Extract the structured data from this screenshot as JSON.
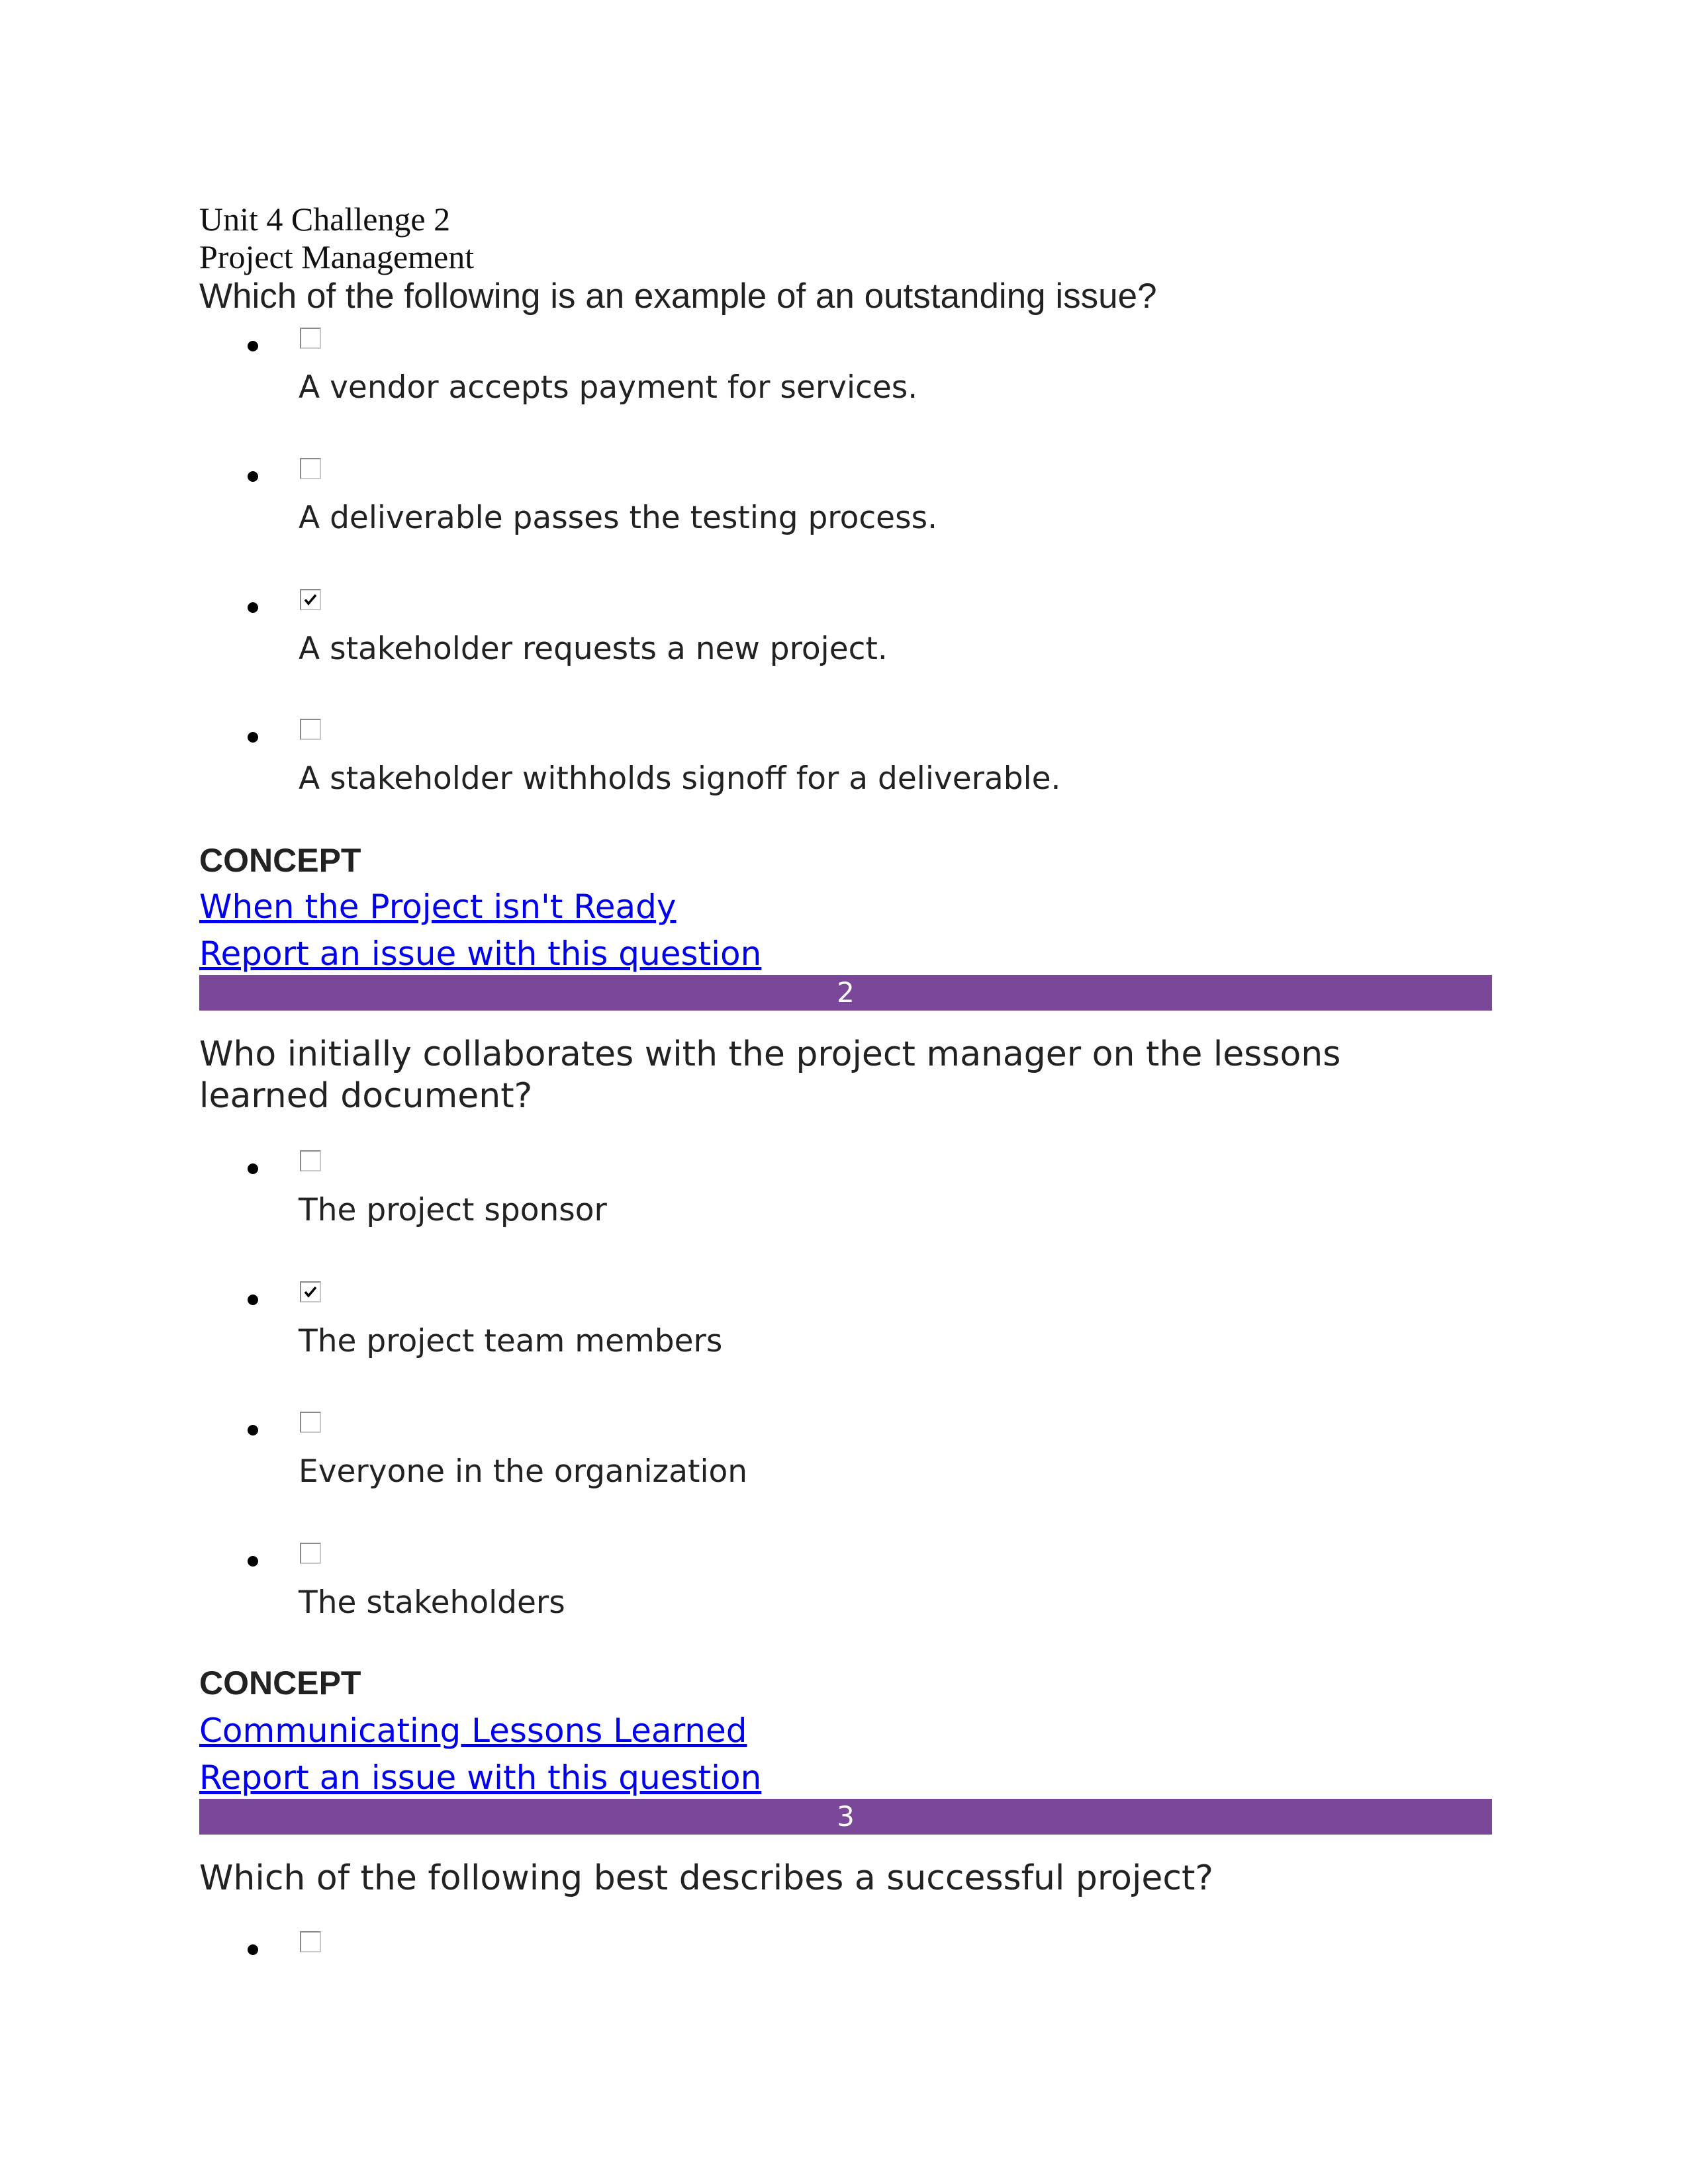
{
  "header": {
    "title": "Unit 4 Challenge 2",
    "subtitle": "Project Management"
  },
  "accent_color": "#7a4799",
  "link_color": "#0000ee",
  "questions": [
    {
      "question": "Which of the following is an example of an outstanding issue?",
      "options": [
        {
          "label": "A vendor accepts payment for services.",
          "checked": false
        },
        {
          "label": "A deliverable passes the testing process.",
          "checked": false
        },
        {
          "label": "A stakeholder requests a new project.",
          "checked": true
        },
        {
          "label": "A stakeholder withholds signoff for a deliverable.",
          "checked": false
        }
      ],
      "concept_heading": "CONCEPT",
      "concept_link": " When the Project isn't Ready",
      "report_link": "Report an issue with this question"
    },
    {
      "number": "2",
      "question_lines": [
        "Who initially collaborates with the project manager on the lessons",
        "learned document?"
      ],
      "options": [
        {
          "label": "The project sponsor",
          "checked": false
        },
        {
          "label": "The project team members",
          "checked": true
        },
        {
          "label": "Everyone in the organization",
          "checked": false
        },
        {
          "label": "The stakeholders",
          "checked": false
        }
      ],
      "concept_heading": "CONCEPT",
      "concept_link": " Communicating Lessons Learned",
      "report_link": "Report an issue with this question"
    },
    {
      "number": "3",
      "question": "Which of the following best describes a successful project?",
      "options": [
        {
          "checked": false
        }
      ]
    }
  ]
}
